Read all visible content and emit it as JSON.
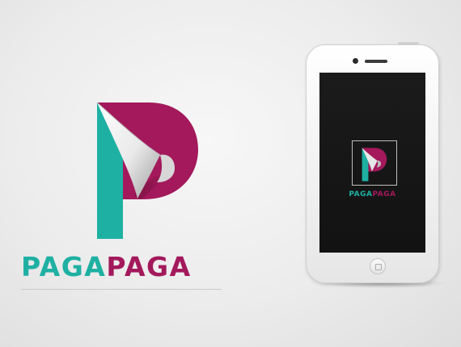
{
  "brand": {
    "part1": "PAGA",
    "part2": "PAGA",
    "teal": "#1eb0a3",
    "magenta": "#a3195b"
  },
  "icons": {
    "logo_mark": "page-curl-p-logo-icon"
  },
  "phone": {
    "part1": "PAGA",
    "part2": "PAGA",
    "screen_color": "#161616"
  }
}
